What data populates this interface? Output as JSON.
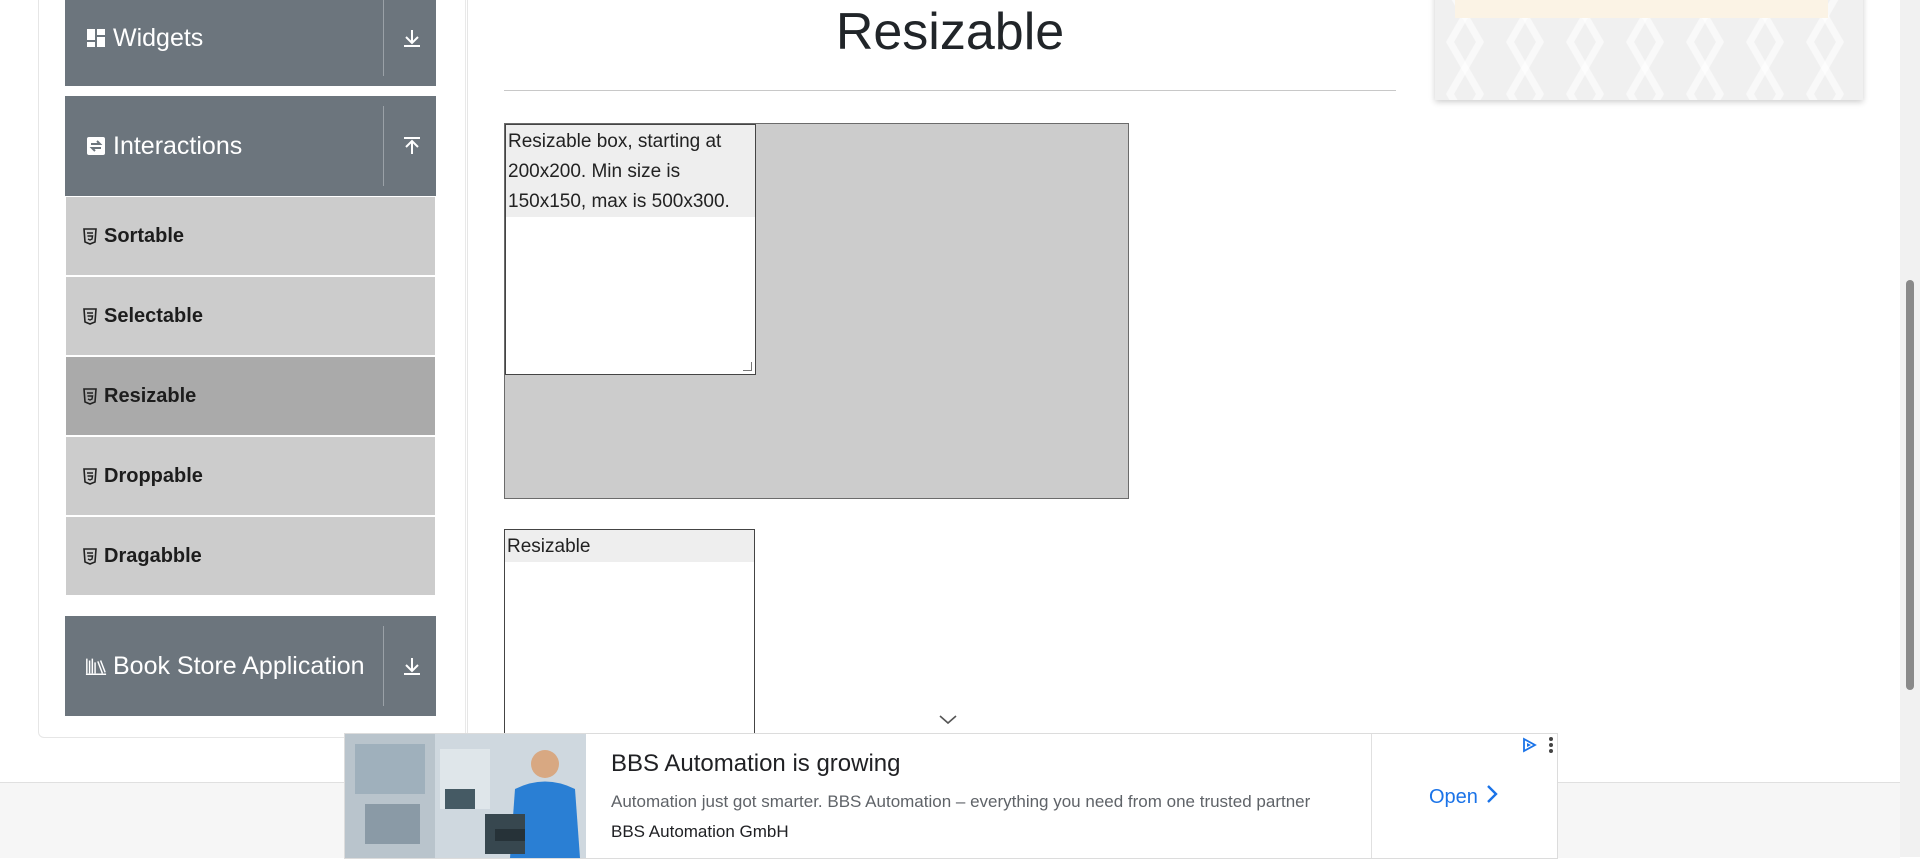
{
  "sidebar": {
    "widgets_group": {
      "title": "Widgets"
    },
    "interactions_group": {
      "title": "Interactions"
    },
    "bookstore_group": {
      "title": "Book Store Application"
    },
    "items": [
      {
        "label": "Sortable",
        "active": false
      },
      {
        "label": "Selectable",
        "active": false
      },
      {
        "label": "Resizable",
        "active": true
      },
      {
        "label": "Droppable",
        "active": false
      },
      {
        "label": "Dragabble",
        "active": false
      }
    ]
  },
  "main": {
    "title": "Resizable",
    "restricted_box_text": "Resizable box, starting at 200x200. Min size is 150x150, max is 500x300.",
    "free_box_text": "Resizable"
  },
  "ad": {
    "headline": "BBS Automation is growing",
    "description": "Automation just got smarter. BBS Automation – everything you need from one trusted partner",
    "advertiser": "BBS Automation GmbH",
    "cta_label": "Open"
  },
  "colors": {
    "sidebar_header": "#6c757d",
    "menu_item": "#cccccc",
    "menu_item_active": "#aaaaaa",
    "ad_link": "#1a73e8"
  },
  "icons": {
    "widgets": "grid-icon",
    "interactions": "swap-icon",
    "bookstore": "books-icon",
    "menu_item": "html5-icon",
    "expand": "download-arrow-icon",
    "collapse": "upload-arrow-icon"
  }
}
